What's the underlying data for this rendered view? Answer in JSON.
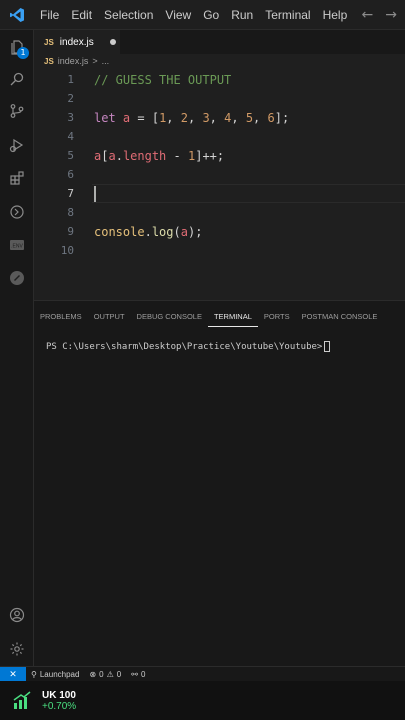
{
  "menu": [
    "File",
    "Edit",
    "Selection",
    "View",
    "Go",
    "Run",
    "Terminal",
    "Help"
  ],
  "activity_badge": "1",
  "tab": {
    "icon_text": "JS",
    "label": "index.js"
  },
  "breadcrumb": {
    "icon_text": "JS",
    "file": "index.js",
    "sep": ">",
    "more": "..."
  },
  "code_lines": [
    {
      "n": "1",
      "tokens": [
        {
          "c": "t-com",
          "t": "// GUESS THE OUTPUT"
        }
      ]
    },
    {
      "n": "2",
      "tokens": []
    },
    {
      "n": "3",
      "tokens": [
        {
          "c": "t-kw",
          "t": "let"
        },
        {
          "c": "t-pl",
          "t": " "
        },
        {
          "c": "t-var",
          "t": "a"
        },
        {
          "c": "t-pl",
          "t": " = ["
        },
        {
          "c": "t-num",
          "t": "1"
        },
        {
          "c": "t-pl",
          "t": ", "
        },
        {
          "c": "t-num",
          "t": "2"
        },
        {
          "c": "t-pl",
          "t": ", "
        },
        {
          "c": "t-num",
          "t": "3"
        },
        {
          "c": "t-pl",
          "t": ", "
        },
        {
          "c": "t-num",
          "t": "4"
        },
        {
          "c": "t-pl",
          "t": ", "
        },
        {
          "c": "t-num",
          "t": "5"
        },
        {
          "c": "t-pl",
          "t": ", "
        },
        {
          "c": "t-num",
          "t": "6"
        },
        {
          "c": "t-pl",
          "t": "];"
        }
      ]
    },
    {
      "n": "4",
      "tokens": []
    },
    {
      "n": "5",
      "tokens": [
        {
          "c": "t-var",
          "t": "a"
        },
        {
          "c": "t-pl",
          "t": "["
        },
        {
          "c": "t-var",
          "t": "a"
        },
        {
          "c": "t-pl",
          "t": "."
        },
        {
          "c": "t-prop",
          "t": "length"
        },
        {
          "c": "t-pl",
          "t": " - "
        },
        {
          "c": "t-num",
          "t": "1"
        },
        {
          "c": "t-pl",
          "t": "]++;"
        }
      ]
    },
    {
      "n": "6",
      "tokens": []
    },
    {
      "n": "7",
      "tokens": []
    },
    {
      "n": "8",
      "tokens": []
    },
    {
      "n": "9",
      "tokens": [
        {
          "c": "t-obj",
          "t": "console"
        },
        {
          "c": "t-pl",
          "t": "."
        },
        {
          "c": "t-fn",
          "t": "log"
        },
        {
          "c": "t-pl",
          "t": "("
        },
        {
          "c": "t-var",
          "t": "a"
        },
        {
          "c": "t-pl",
          "t": ");"
        }
      ]
    },
    {
      "n": "10",
      "tokens": []
    }
  ],
  "active_line": "7",
  "panel_tabs": [
    "PROBLEMS",
    "OUTPUT",
    "DEBUG CONSOLE",
    "TERMINAL",
    "PORTS",
    "POSTMAN CONSOLE"
  ],
  "active_panel_tab": "TERMINAL",
  "terminal_prompt": "PS C:\\Users\\sharm\\Desktop\\Practice\\Youtube\\Youtube>",
  "status": {
    "launchpad": "Launchpad",
    "errors": "0",
    "warnings": "0",
    "ports": "0"
  },
  "ticker": {
    "name": "UK 100",
    "change": "+0.70%"
  },
  "colors": {
    "accent": "#0078d4",
    "ticker_up": "#4ade80"
  }
}
